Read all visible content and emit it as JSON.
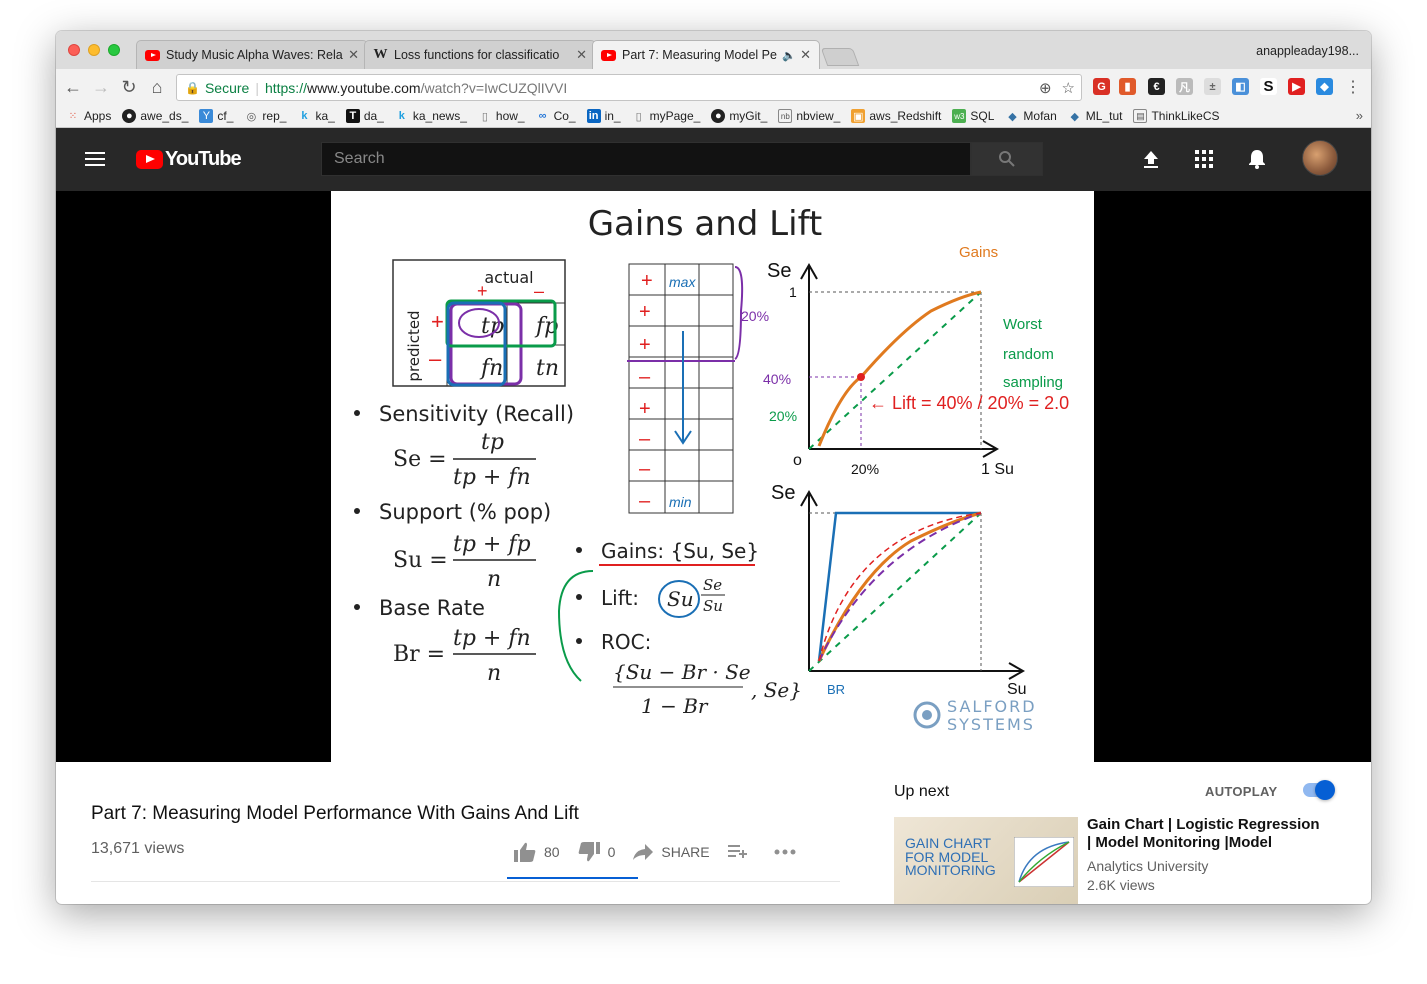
{
  "browser": {
    "tabs": [
      {
        "title": "Study Music Alpha Waves: Rela",
        "favicon": "youtube-icon",
        "active": false
      },
      {
        "title": "Loss functions for classificatio",
        "favicon": "wikipedia-icon",
        "active": false
      },
      {
        "title": "Part 7: Measuring Model Pe",
        "favicon": "youtube-icon",
        "active": true,
        "audio": true
      }
    ],
    "profile": "anappleaday198...",
    "omnibox": {
      "secure_label": "Secure",
      "url_scheme": "https://",
      "url_host": "www.youtube.com",
      "url_path": "/watch?v=IwCUZQlIVVI"
    },
    "bookmarks": [
      {
        "label": "Apps",
        "icon": "apps-grid-icon"
      },
      {
        "label": "awe_ds_",
        "icon": "github-icon"
      },
      {
        "label": "cf_",
        "icon": "cf-icon"
      },
      {
        "label": "rep_",
        "icon": "rep-icon"
      },
      {
        "label": "ka_",
        "icon": "k-icon"
      },
      {
        "label": "da_",
        "icon": "t-icon"
      },
      {
        "label": "ka_news_",
        "icon": "k-icon"
      },
      {
        "label": "how_",
        "icon": "page-icon"
      },
      {
        "label": "Co_",
        "icon": "co-icon"
      },
      {
        "label": "in_",
        "icon": "linkedin-icon"
      },
      {
        "label": "myPage_",
        "icon": "page-icon"
      },
      {
        "label": "myGit_",
        "icon": "github-icon"
      },
      {
        "label": "nbview_",
        "icon": "nb-icon"
      },
      {
        "label": "aws_Redshift",
        "icon": "aws-icon"
      },
      {
        "label": "SQL",
        "icon": "w3-icon"
      },
      {
        "label": "Mofan",
        "icon": "python-icon"
      },
      {
        "label": "ML_tut",
        "icon": "python-icon"
      },
      {
        "label": "ThinkLikeCS",
        "icon": "page-icon"
      }
    ],
    "bookmarks_more": "»"
  },
  "youtube": {
    "logo_text": "YouTube",
    "search_placeholder": "Search",
    "slide": {
      "title": "Gains and Lift",
      "matrix_actual": "actual",
      "matrix_predicted": "predicted",
      "sensitivity": "Sensitivity (Recall)",
      "support": "Support (% pop)",
      "base_rate": "Base Rate",
      "gains": "Gains: {Su, Se}",
      "lift": "Lift:",
      "roc": "ROC:",
      "brand_line1": "SALFORD",
      "brand_line2": "SYSTEMS"
    },
    "video": {
      "title": "Part 7: Measuring Model Performance With Gains And Lift",
      "views": "13,671 views",
      "likes": "80",
      "dislikes": "0",
      "share": "SHARE"
    },
    "sidebar": {
      "up_next": "Up next",
      "autoplay": "AUTOPLAY",
      "recommendation": {
        "thumb_text": "GAIN CHART\nFOR MODEL\nMONITORING",
        "title": "Gain Chart | Logistic Regression | Model Monitoring |Model",
        "channel": "Analytics University",
        "views": "2.6K views"
      }
    }
  }
}
